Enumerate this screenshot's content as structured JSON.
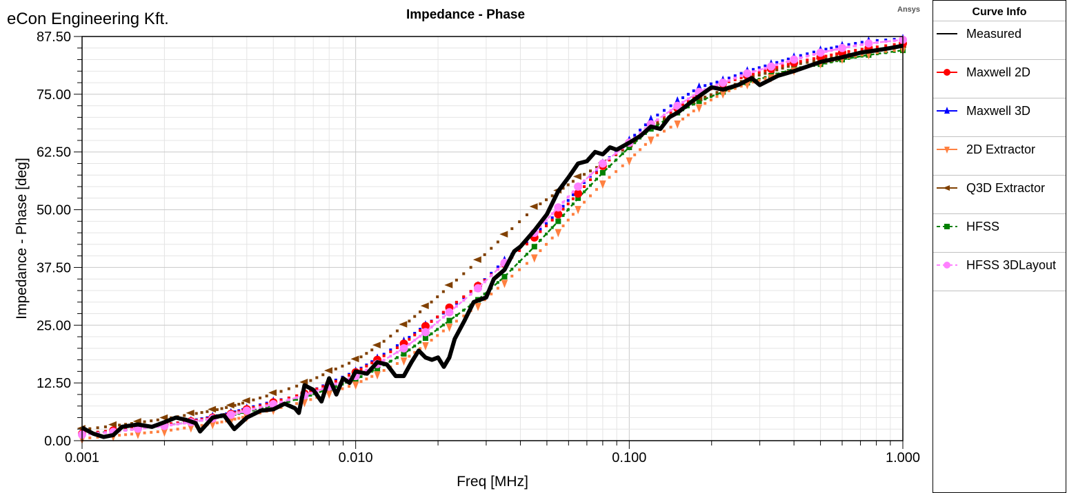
{
  "header": {
    "company": "eCon Engineering Kft.",
    "brand": "Ansys"
  },
  "legend": {
    "title": "Curve Info",
    "items": [
      {
        "label": "Measured",
        "color": "#000000",
        "marker": "none",
        "line": "solid"
      },
      {
        "label": "Maxwell 2D",
        "color": "#ff0000",
        "marker": "circle",
        "line": "solid"
      },
      {
        "label": "Maxwell 3D",
        "color": "#0000ff",
        "marker": "triangle-up",
        "line": "dotted"
      },
      {
        "label": "2D Extractor",
        "color": "#ff8040",
        "marker": "triangle-down",
        "line": "dotted"
      },
      {
        "label": "Q3D Extractor",
        "color": "#804000",
        "marker": "triangle-left",
        "line": "dotted"
      },
      {
        "label": "HFSS",
        "color": "#008000",
        "marker": "square",
        "line": "dashed"
      },
      {
        "label": "HFSS 3DLayout",
        "color": "#ff80ff",
        "marker": "circle",
        "line": "dashed"
      }
    ]
  },
  "chart_data": {
    "type": "line",
    "title": "Impedance - Phase",
    "xlabel": "Freq [MHz]",
    "ylabel": "Impedance - Phase [deg]",
    "xscale": "log",
    "xlim": [
      0.001,
      1.0
    ],
    "ylim": [
      0,
      87.5
    ],
    "x_ticks": [
      "0.001",
      "0.010",
      "0.100",
      "1.000"
    ],
    "y_ticks": [
      "0.00",
      "12.50",
      "25.00",
      "37.50",
      "50.00",
      "62.50",
      "75.00",
      "87.50"
    ],
    "grid": true,
    "legend_position": "right-outside",
    "series": [
      {
        "name": "Measured",
        "x": [
          0.001,
          0.0011,
          0.0012,
          0.0013,
          0.0014,
          0.0016,
          0.0018,
          0.002,
          0.0022,
          0.0024,
          0.0026,
          0.0027,
          0.003,
          0.0033,
          0.0036,
          0.004,
          0.0045,
          0.005,
          0.0055,
          0.006,
          0.0062,
          0.0065,
          0.007,
          0.0075,
          0.008,
          0.0085,
          0.009,
          0.0095,
          0.01,
          0.011,
          0.012,
          0.013,
          0.014,
          0.015,
          0.016,
          0.017,
          0.018,
          0.019,
          0.02,
          0.021,
          0.022,
          0.023,
          0.025,
          0.027,
          0.03,
          0.032,
          0.035,
          0.038,
          0.04,
          0.045,
          0.05,
          0.055,
          0.06,
          0.065,
          0.07,
          0.075,
          0.08,
          0.085,
          0.09,
          0.1,
          0.11,
          0.12,
          0.13,
          0.14,
          0.15,
          0.17,
          0.2,
          0.22,
          0.25,
          0.28,
          0.3,
          0.35,
          0.4,
          0.5,
          0.6,
          0.7,
          0.8,
          0.9,
          1.0
        ],
        "y": [
          2.8,
          1.5,
          0.8,
          1.2,
          3.0,
          3.5,
          3.0,
          4.0,
          5.0,
          4.5,
          3.8,
          2.0,
          5.0,
          5.5,
          2.5,
          5.0,
          6.5,
          6.8,
          8.0,
          7.0,
          6.0,
          12.0,
          11.0,
          8.5,
          13.5,
          10.0,
          13.5,
          12.5,
          15.0,
          14.5,
          17.0,
          16.5,
          14.0,
          14.0,
          17.0,
          19.5,
          18.0,
          17.5,
          18.0,
          16.0,
          18.0,
          22.0,
          26.0,
          30.0,
          31.0,
          35.0,
          37.0,
          41.0,
          42.0,
          45.5,
          49.0,
          54.0,
          57.0,
          60.0,
          60.5,
          62.5,
          62.0,
          63.5,
          63.0,
          64.5,
          66.0,
          68.0,
          67.5,
          70.0,
          71.0,
          73.5,
          76.5,
          76.0,
          77.0,
          78.5,
          77.0,
          79.0,
          80.0,
          82.0,
          83.0,
          84.0,
          84.5,
          85.0,
          85.5
        ]
      },
      {
        "name": "Maxwell 2D",
        "x": [
          0.001,
          0.0013,
          0.0016,
          0.002,
          0.0025,
          0.003,
          0.0035,
          0.004,
          0.005,
          0.0065,
          0.008,
          0.01,
          0.012,
          0.015,
          0.018,
          0.022,
          0.028,
          0.035,
          0.045,
          0.055,
          0.065,
          0.08,
          0.1,
          0.12,
          0.15,
          0.18,
          0.22,
          0.27,
          0.33,
          0.4,
          0.5,
          0.6,
          0.75,
          1.0
        ],
        "y": [
          1.5,
          2.2,
          2.8,
          3.5,
          4.2,
          5.0,
          5.8,
          6.8,
          8.3,
          10.2,
          12.2,
          14.8,
          17.5,
          21.0,
          24.8,
          28.8,
          33.5,
          38.3,
          44.0,
          49.0,
          53.5,
          59.5,
          64.5,
          68.5,
          72.0,
          75.0,
          77.3,
          79.0,
          80.5,
          81.8,
          83.0,
          84.0,
          85.0,
          86.0
        ]
      },
      {
        "name": "Maxwell 3D",
        "x": [
          0.001,
          0.0013,
          0.0016,
          0.002,
          0.0025,
          0.003,
          0.0035,
          0.004,
          0.005,
          0.0065,
          0.008,
          0.01,
          0.012,
          0.015,
          0.018,
          0.022,
          0.028,
          0.035,
          0.045,
          0.055,
          0.065,
          0.08,
          0.1,
          0.12,
          0.15,
          0.18,
          0.22,
          0.27,
          0.33,
          0.4,
          0.5,
          0.6,
          0.75,
          1.0
        ],
        "y": [
          1.6,
          2.0,
          2.8,
          3.4,
          4.3,
          5.2,
          6.0,
          7.0,
          8.5,
          10.0,
          12.5,
          15.0,
          17.8,
          21.5,
          25.0,
          28.5,
          33.5,
          39.0,
          44.5,
          49.5,
          54.5,
          60.0,
          65.0,
          69.5,
          73.5,
          76.5,
          78.0,
          80.0,
          81.5,
          83.0,
          84.5,
          85.5,
          86.5,
          87.0
        ]
      },
      {
        "name": "2D Extractor",
        "x": [
          0.001,
          0.0013,
          0.0016,
          0.002,
          0.0025,
          0.003,
          0.0035,
          0.004,
          0.005,
          0.0065,
          0.008,
          0.01,
          0.012,
          0.015,
          0.018,
          0.022,
          0.028,
          0.035,
          0.045,
          0.055,
          0.065,
          0.08,
          0.1,
          0.12,
          0.15,
          0.18,
          0.22,
          0.27,
          0.33,
          0.4,
          0.5,
          0.6,
          0.75,
          1.0
        ],
        "y": [
          1.2,
          1.8,
          2.3,
          2.8,
          3.7,
          4.4,
          5.2,
          6.0,
          7.5,
          9.2,
          11.0,
          13.0,
          15.2,
          18.2,
          21.5,
          25.5,
          30.0,
          35.0,
          40.5,
          46.0,
          51.0,
          56.5,
          61.5,
          66.0,
          69.5,
          73.0,
          76.0,
          78.0,
          79.5,
          81.0,
          82.5,
          83.5,
          84.5,
          85.5
        ]
      },
      {
        "name": "Q3D Extractor",
        "x": [
          0.001,
          0.0013,
          0.0016,
          0.002,
          0.0025,
          0.003,
          0.0035,
          0.004,
          0.005,
          0.0065,
          0.008,
          0.01,
          0.012,
          0.015,
          0.018,
          0.022,
          0.028,
          0.035,
          0.045,
          0.055,
          0.065,
          0.08,
          0.1,
          0.12,
          0.15,
          0.18,
          0.22,
          0.27,
          0.33,
          0.4,
          0.5,
          0.6,
          0.75,
          1.0
        ],
        "y": [
          1.5,
          2.3,
          3.0,
          3.8,
          4.8,
          5.6,
          6.5,
          7.5,
          9.2,
          11.5,
          14.0,
          16.5,
          19.5,
          24.0,
          28.0,
          32.5,
          38.0,
          43.5,
          49.5,
          53.0,
          56.0,
          59.0,
          63.0,
          67.0,
          70.5,
          73.0,
          75.0,
          77.5,
          79.0,
          80.5,
          81.5,
          82.5,
          83.5,
          84.5
        ]
      },
      {
        "name": "HFSS",
        "x": [
          0.001,
          0.0013,
          0.0016,
          0.002,
          0.0025,
          0.003,
          0.0035,
          0.004,
          0.005,
          0.0065,
          0.008,
          0.01,
          0.012,
          0.015,
          0.018,
          0.022,
          0.028,
          0.035,
          0.045,
          0.055,
          0.065,
          0.08,
          0.1,
          0.12,
          0.15,
          0.18,
          0.22,
          0.27,
          0.33,
          0.4,
          0.5,
          0.6,
          0.75,
          1.0
        ],
        "y": [
          1.4,
          2.0,
          2.6,
          3.3,
          4.0,
          4.8,
          5.5,
          6.3,
          7.6,
          9.4,
          11.2,
          13.3,
          15.6,
          18.8,
          22.2,
          26.0,
          30.5,
          35.5,
          42.0,
          47.5,
          52.5,
          58.0,
          63.5,
          67.5,
          71.0,
          73.5,
          75.5,
          77.5,
          79.0,
          80.5,
          81.5,
          82.5,
          83.5,
          84.5
        ]
      },
      {
        "name": "HFSS 3DLayout",
        "x": [
          0.001,
          0.0013,
          0.0016,
          0.002,
          0.0025,
          0.003,
          0.0035,
          0.004,
          0.005,
          0.0065,
          0.008,
          0.01,
          0.012,
          0.015,
          0.018,
          0.022,
          0.028,
          0.035,
          0.045,
          0.055,
          0.065,
          0.08,
          0.1,
          0.12,
          0.15,
          0.18,
          0.22,
          0.27,
          0.33,
          0.4,
          0.5,
          0.6,
          0.75,
          1.0
        ],
        "y": [
          1.3,
          1.9,
          2.6,
          3.2,
          4.0,
          4.8,
          5.6,
          6.5,
          7.9,
          9.8,
          11.7,
          14.0,
          16.6,
          20.0,
          23.5,
          27.8,
          33.0,
          38.5,
          45.0,
          50.5,
          55.0,
          60.0,
          64.5,
          68.5,
          72.5,
          75.5,
          77.5,
          79.5,
          81.0,
          82.5,
          84.0,
          85.0,
          86.0,
          86.8
        ]
      }
    ]
  }
}
